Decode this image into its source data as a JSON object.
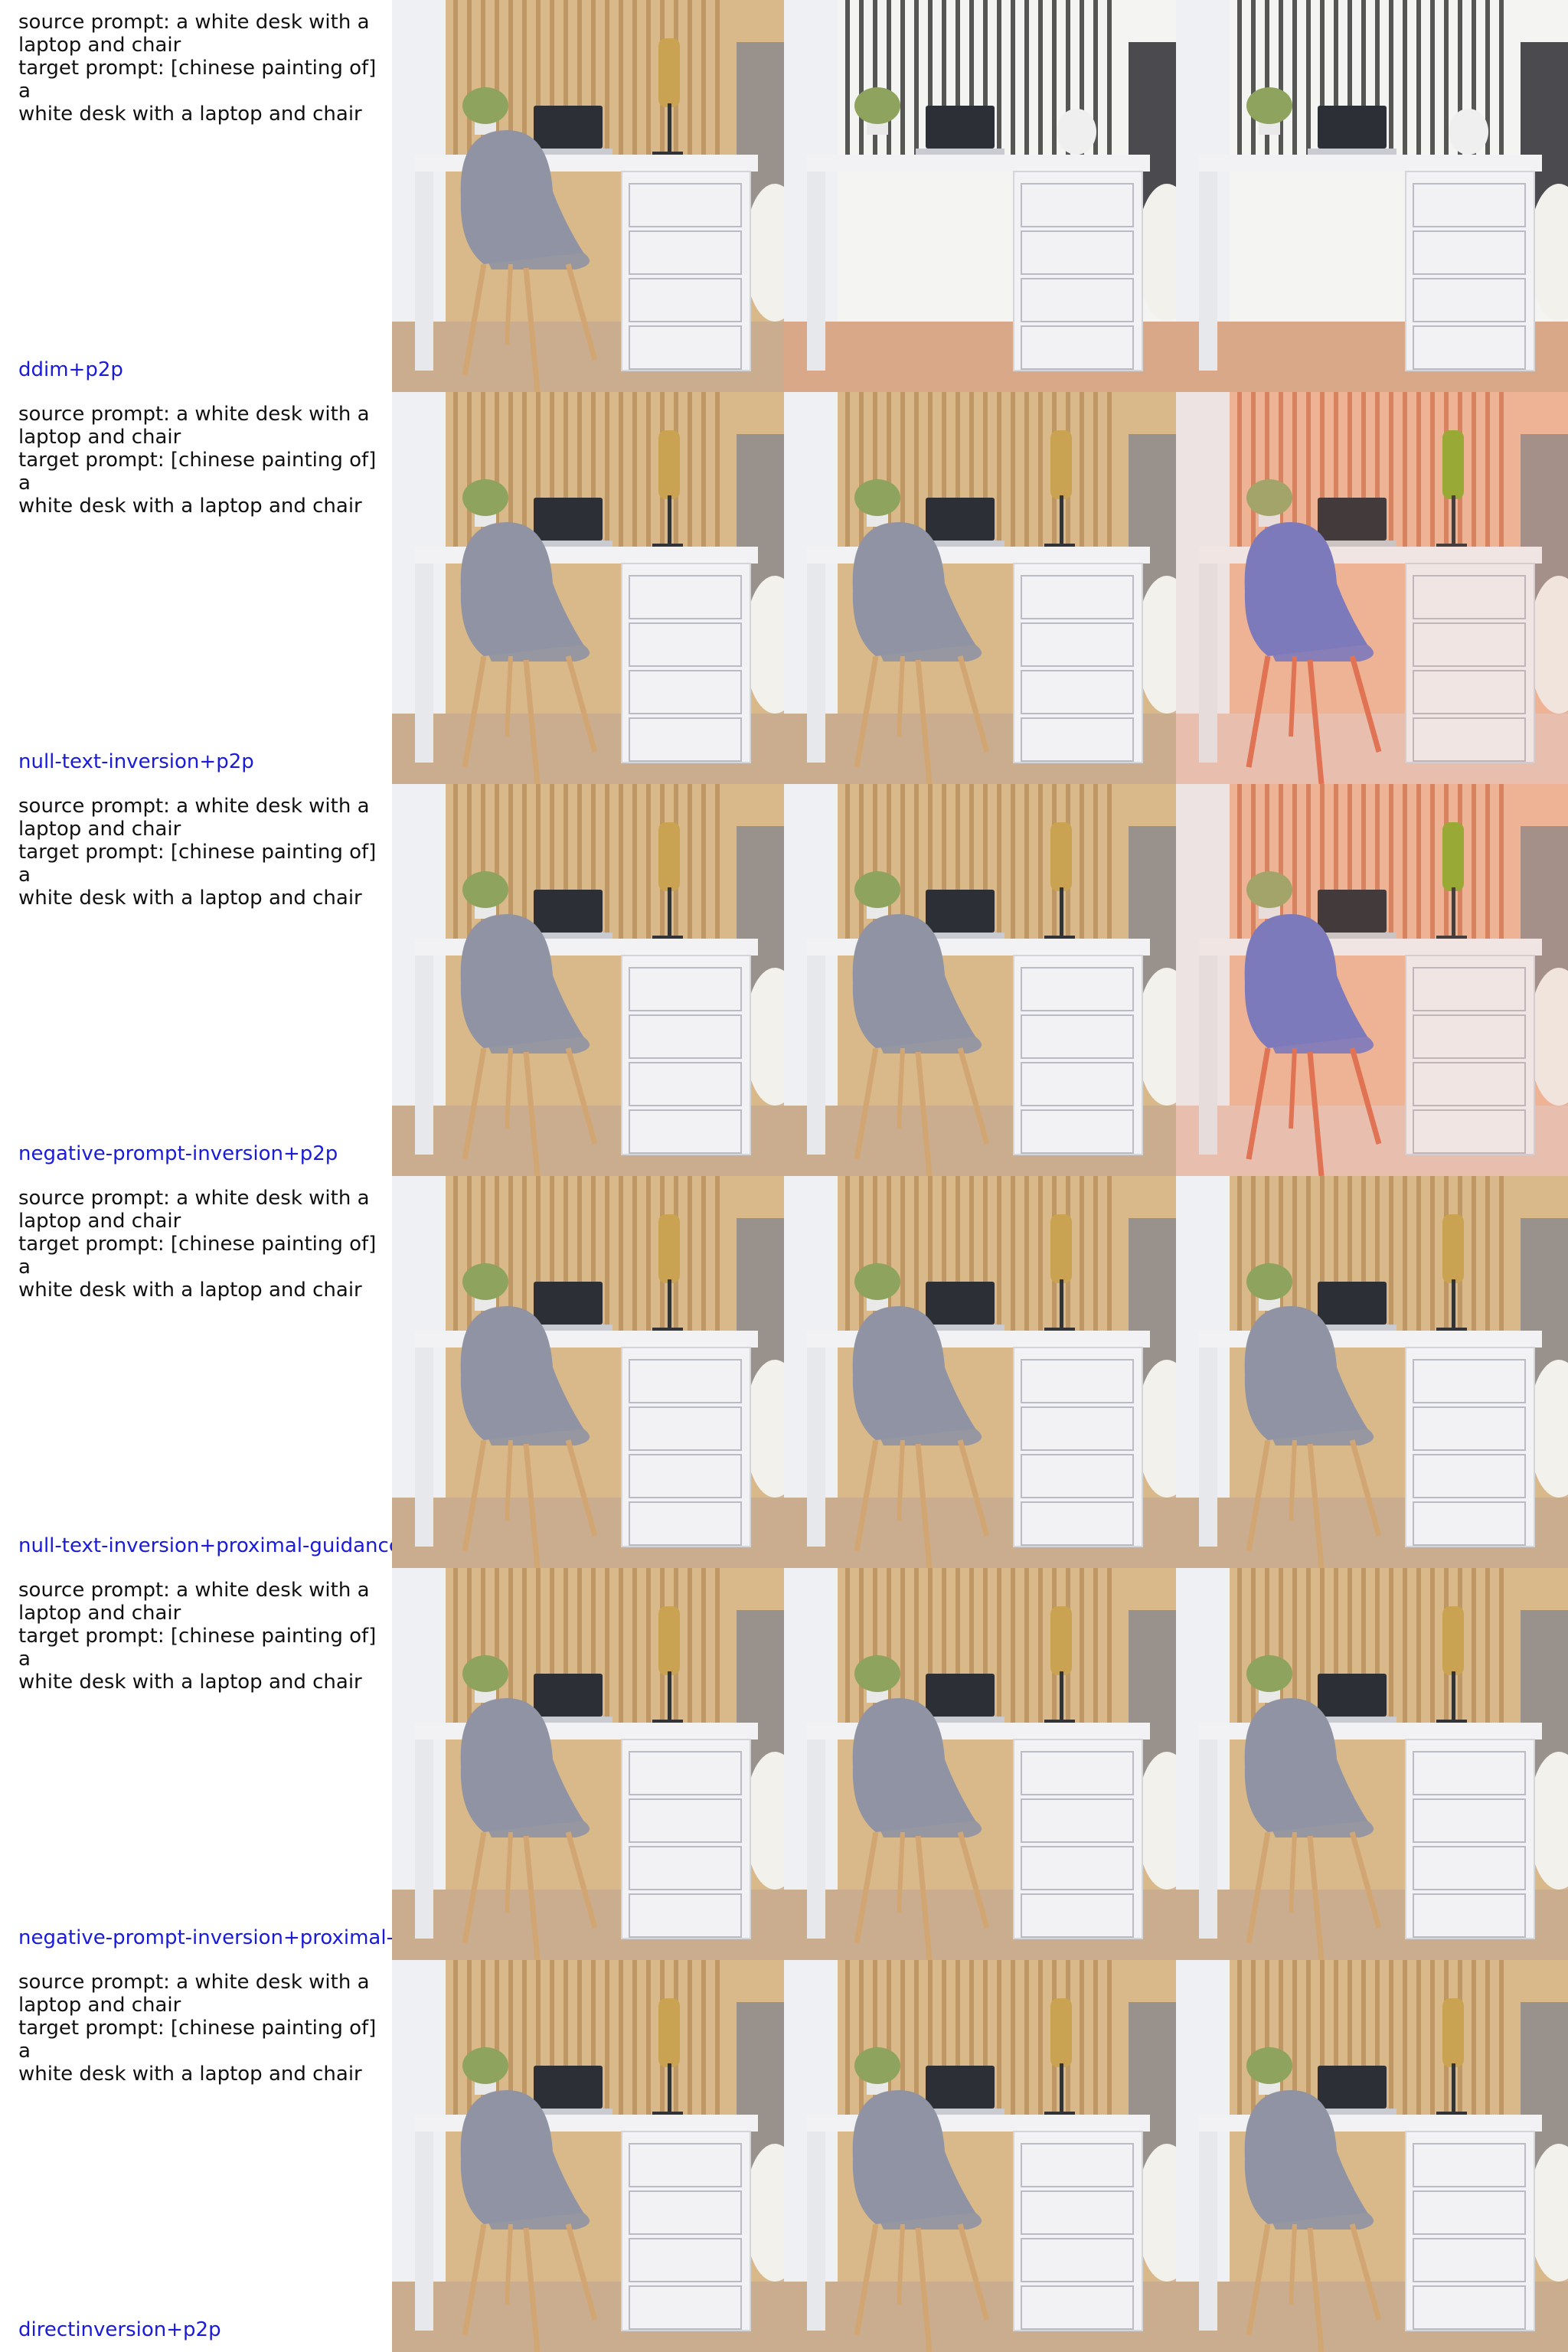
{
  "rows": [
    {
      "prompt": "source prompt: a white desk with a\nlaptop and chair\ntarget prompt: [chinese painting of] a\nwhite desk with a laptop and chair",
      "method": "ddim+p2p"
    },
    {
      "prompt": "source prompt: a white desk with a\nlaptop and chair\ntarget prompt: [chinese painting of] a\nwhite desk with a laptop and chair",
      "method": "null-text-inversion+p2p"
    },
    {
      "prompt": "source prompt: a white desk with a\nlaptop and chair\ntarget prompt: [chinese painting of] a\nwhite desk with a laptop and chair",
      "method": "negative-prompt-inversion+p2p"
    },
    {
      "prompt": "source prompt: a white desk with a\nlaptop and chair\ntarget prompt: [chinese painting of] a\nwhite desk with a laptop and chair",
      "method": "null-text-inversion+proximal-guidance"
    },
    {
      "prompt": "source prompt: a white desk with a\nlaptop and chair\ntarget prompt: [chinese painting of] a\nwhite desk with a laptop and chair",
      "method": "negative-prompt-inversion+proximal-g"
    },
    {
      "prompt": "source prompt: a white desk with a\nlaptop and chair\ntarget prompt: [chinese painting of] a\nwhite desk with a laptop and chair",
      "method": "directinversion+p2p"
    }
  ],
  "colors": {
    "method_label": "#1a1adb",
    "wall_wood": "#d9b88a",
    "desk": "#f2f2f4",
    "chair": "#8f93a3",
    "painted_tint": "#e88a6a"
  }
}
